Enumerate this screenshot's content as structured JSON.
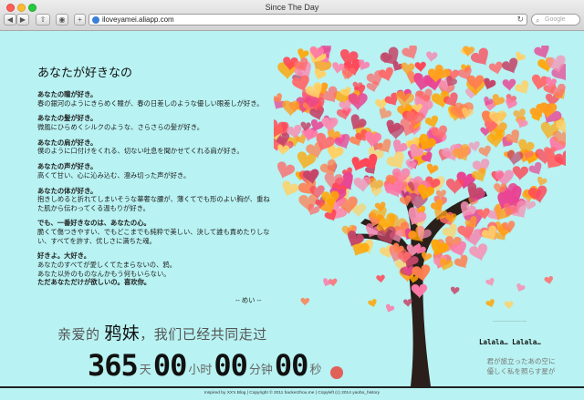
{
  "window": {
    "title": "Since The Day",
    "url": "iloveyamei.aliapp.com",
    "search_placeholder": "Google"
  },
  "toolbar": {
    "back_label": "◀",
    "forward_label": "▶",
    "share_label": "⇧",
    "icloud_label": "◉",
    "newtab_label": "+",
    "reload_label": "↻"
  },
  "letter": {
    "heading": "あなたが好きなの",
    "stanzas": [
      {
        "title": "あなたの瞳が好き。",
        "lines": [
          "春の銀河のようにきらめく瞳が、春の日差しのような優しい眼差しが好き。"
        ]
      },
      {
        "title": "あなたの髪が好き。",
        "lines": [
          "微風にひらめくシルクのような、さらさらの髪が好き。"
        ]
      },
      {
        "title": "あなたの肩が好き。",
        "lines": [
          "僕のように口付けをくれる、切ない吐息を聞かせてくれる肩が好き。"
        ]
      },
      {
        "title": "あなたの声が好き。",
        "lines": [
          "高くて甘い、心に沁み込む、澄み切った声が好き。"
        ]
      },
      {
        "title": "あなたの体が好き。",
        "lines": [
          "抱きしめると折れてしまいそうな華奢な腰が、薄くてでも形のよい胸が、重ねた肌から伝わってくる温もりが好き。"
        ]
      },
      {
        "title": "でも、一番好きなのは、あなたの心。",
        "lines": [
          "脆くて傷つきやすい、でもどこまでも純粋で美しい、決して誰も責めたりしない、すべてを許す、优しさに満ちた魂。"
        ]
      },
      {
        "title": "好きよ。大好き。",
        "lines": [
          "あなたのすべてが愛しくてたまらないの、鸦。",
          "あなた以外のものなんかもう何もいらない。"
        ],
        "closing": "ただあなただけが欲しいの。喜欢你。"
      }
    ],
    "signature": "-- めい --"
  },
  "counter": {
    "prefix": "亲爱的",
    "name": "鸦妹",
    "suffix": "，我们已经共同走过",
    "days": "365",
    "days_unit": "天",
    "hours": "00",
    "hours_unit": "小时",
    "minutes": "00",
    "minutes_unit": "分钟",
    "seconds": "00",
    "seconds_unit": "秒"
  },
  "side": {
    "lala": "Lalala… Lalala…",
    "lyric_lines": [
      "君が旅立ったあの空に",
      "優しく私を照らす星が"
    ]
  },
  "footer": {
    "text": "Inspired by XX's Blog | Copyright © 2011 hackerzhou.me | Copyleft (c) 2014 yaobo_history"
  },
  "colors": {
    "background": "#b8f2f2",
    "trunk": "#2a1f1a",
    "hearts": [
      "#ff6b6b",
      "#ff9f1c",
      "#ffd166",
      "#f78fb3",
      "#e84393",
      "#fd79a8",
      "#ff4757",
      "#ffa502",
      "#c44569",
      "#ff7f50"
    ]
  }
}
